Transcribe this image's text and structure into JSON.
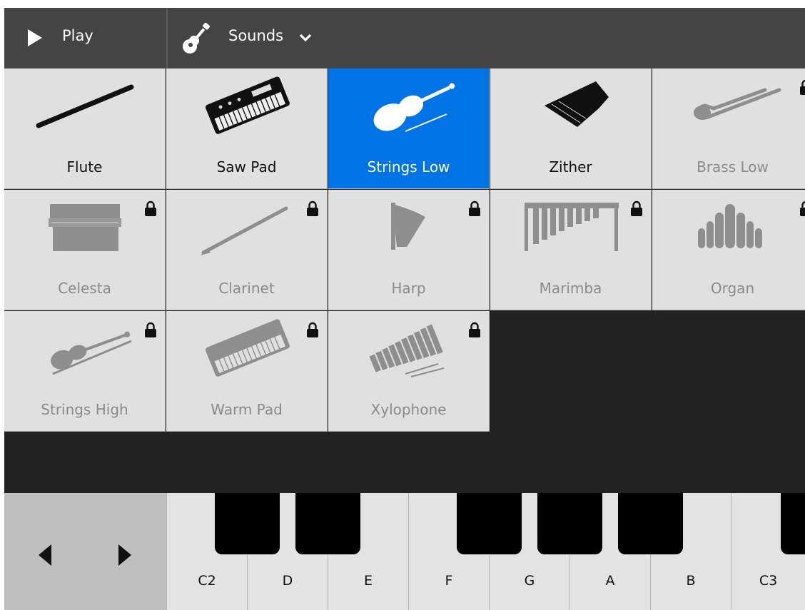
{
  "toolbar": {
    "play_label": "Play",
    "sounds_label": "Sounds"
  },
  "instruments": [
    {
      "name": "Flute",
      "icon": "flute-icon",
      "locked": false,
      "selected": false
    },
    {
      "name": "Saw Pad",
      "icon": "keyboard-synth-icon",
      "locked": false,
      "selected": false
    },
    {
      "name": "Strings Low",
      "icon": "cello-icon",
      "locked": false,
      "selected": true
    },
    {
      "name": "Zither",
      "icon": "zither-icon",
      "locked": false,
      "selected": false
    },
    {
      "name": "Brass Low",
      "icon": "trombone-icon",
      "locked": true,
      "selected": false
    },
    {
      "name": "Celesta",
      "icon": "celesta-icon",
      "locked": true,
      "selected": false
    },
    {
      "name": "Clarinet",
      "icon": "clarinet-icon",
      "locked": true,
      "selected": false
    },
    {
      "name": "Harp",
      "icon": "harp-icon",
      "locked": true,
      "selected": false
    },
    {
      "name": "Marimba",
      "icon": "marimba-icon",
      "locked": true,
      "selected": false
    },
    {
      "name": "Organ",
      "icon": "organ-icon",
      "locked": true,
      "selected": false
    },
    {
      "name": "Strings High",
      "icon": "violin-icon",
      "locked": true,
      "selected": false
    },
    {
      "name": "Warm Pad",
      "icon": "keyboard-synth-icon",
      "locked": true,
      "selected": false
    },
    {
      "name": "Xylophone",
      "icon": "xylophone-icon",
      "locked": true,
      "selected": false
    }
  ],
  "keyboard": {
    "white_keys": [
      "C2",
      "D",
      "E",
      "F",
      "G",
      "A",
      "B",
      "C3"
    ]
  },
  "colors": {
    "selected": "#0074e4",
    "topbar": "#444444",
    "tile": "#e0e0e0",
    "locked_text": "#8a8a8a"
  }
}
